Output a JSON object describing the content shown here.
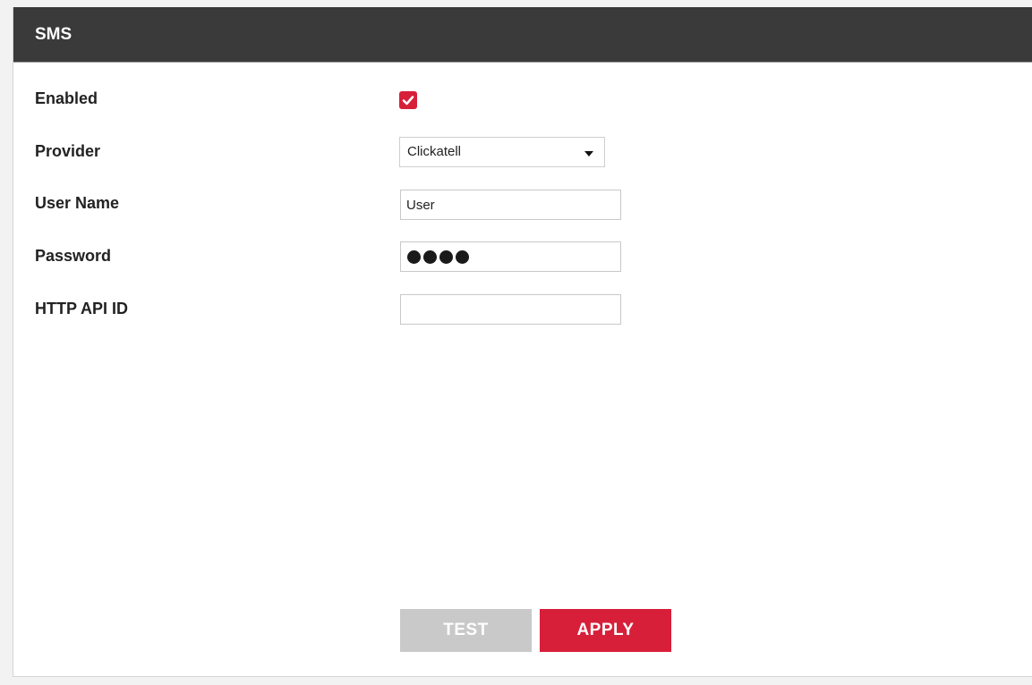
{
  "panel": {
    "title": "SMS"
  },
  "fields": {
    "enabled": {
      "label": "Enabled",
      "checked": true
    },
    "provider": {
      "label": "Provider",
      "value": "Clickatell"
    },
    "username": {
      "label": "User Name",
      "value": "User"
    },
    "password": {
      "label": "Password",
      "masked_length": 4
    },
    "http_api_id": {
      "label": "HTTP API ID",
      "value": ""
    }
  },
  "buttons": {
    "test_label": "TEST",
    "apply_label": "APPLY"
  },
  "colors": {
    "header_bg": "#3a3a3a",
    "accent": "#d71f3a",
    "disabled_button": "#c9c9c9"
  }
}
